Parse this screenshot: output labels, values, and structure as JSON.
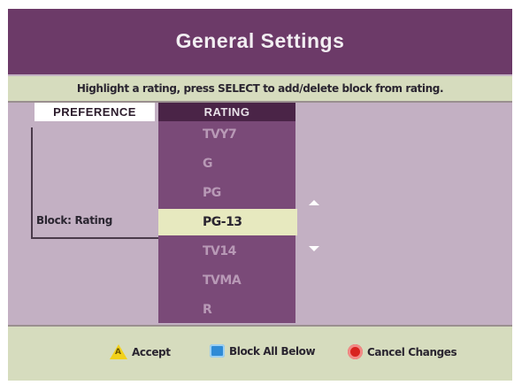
{
  "header": {
    "title": "General Settings"
  },
  "instruction": "Highlight a rating, press SELECT to add/delete block from rating.",
  "columns": {
    "preference": "PREFERENCE",
    "rating": "RATING"
  },
  "preference": {
    "label": "Block: Rating"
  },
  "ratings": [
    {
      "label": "TVY7",
      "selected": false
    },
    {
      "label": "G",
      "selected": false
    },
    {
      "label": "PG",
      "selected": false
    },
    {
      "label": "PG-13",
      "selected": true
    },
    {
      "label": "TV14",
      "selected": false
    },
    {
      "label": "TVMA",
      "selected": false
    },
    {
      "label": "R",
      "selected": false
    }
  ],
  "scroll_icons": {
    "up": "up-arrow-icon",
    "down": "down-arrow-icon"
  },
  "footer": {
    "accept": {
      "label": "Accept",
      "icon": "yellow-triangle-a-icon",
      "color": "#f2d11a"
    },
    "block_all": {
      "label": "Block All Below",
      "icon": "blue-square-icon",
      "color": "#2f8bd6"
    },
    "cancel": {
      "label": "Cancel Changes",
      "icon": "red-circle-icon",
      "color": "#d8231f"
    }
  },
  "colors": {
    "header_bg": "#6c3a68",
    "body_bg": "#c3b0c3",
    "rating_bg": "#7a4a78",
    "highlight_bg": "#e7e9bf",
    "bar_bg": "#d6dcbe"
  }
}
